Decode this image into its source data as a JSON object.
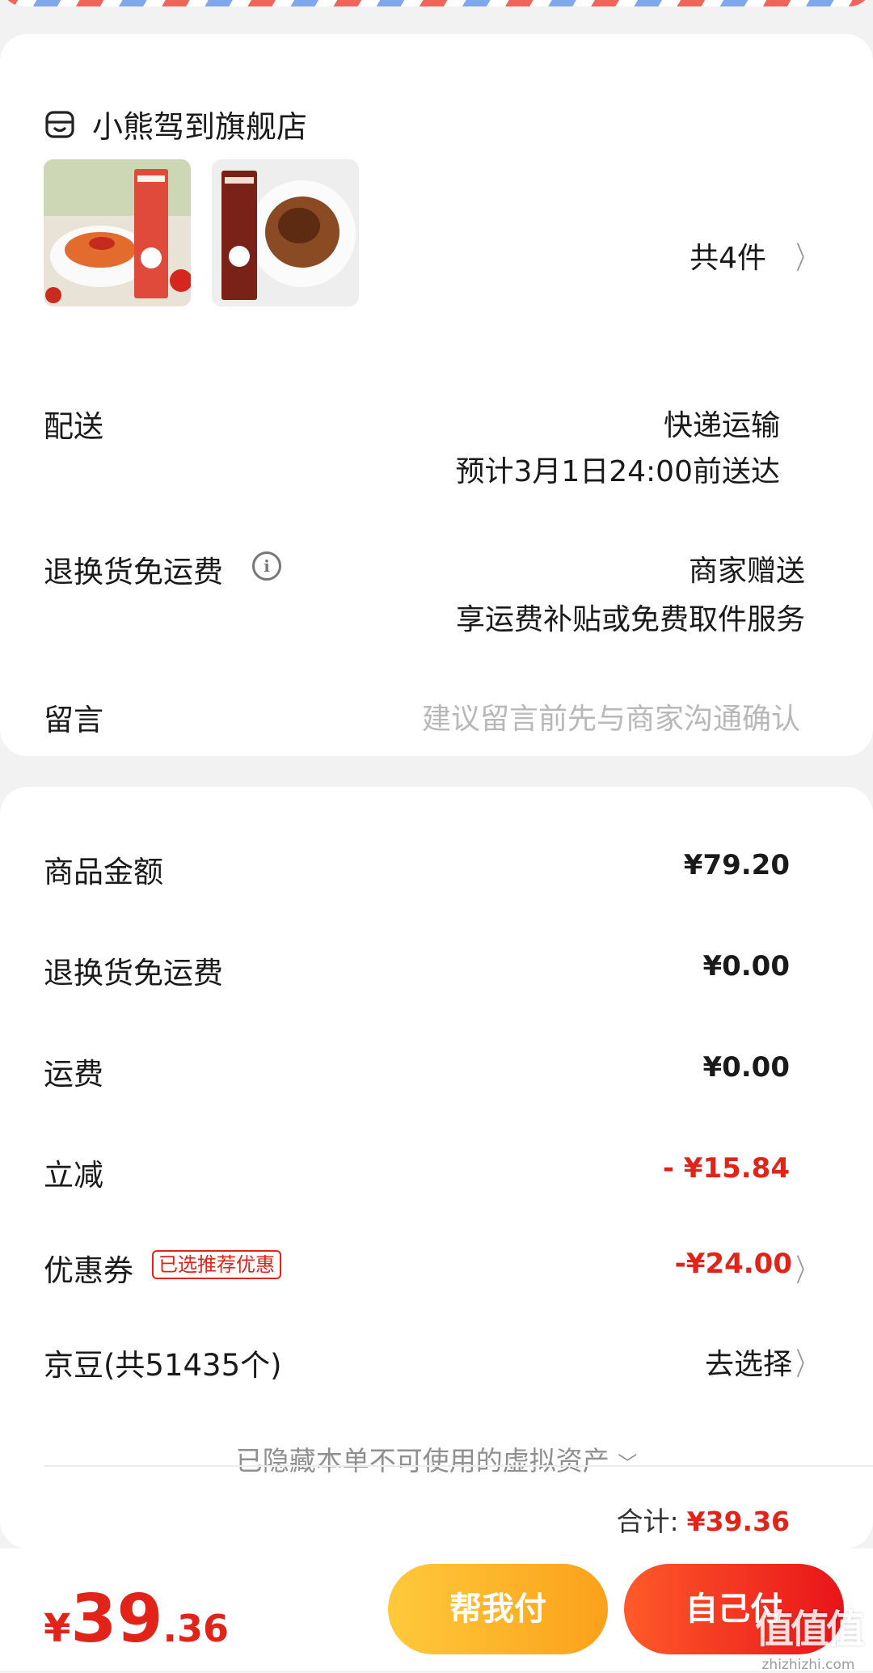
{
  "shop": {
    "icon": "store-icon",
    "name": "小熊驾到旗舰店",
    "products": [
      {
        "image": "tomato-spaghetti-image"
      },
      {
        "image": "beef-spaghetti-image"
      }
    ],
    "count_label": "共4件"
  },
  "delivery": {
    "label": "配送",
    "method": "快递运输",
    "eta": "预计3月1日24:00前送达"
  },
  "return_shipping": {
    "label": "退换货免运费",
    "info_icon": "info-icon",
    "value": "商家赠送",
    "desc": "享运费补贴或免费取件服务"
  },
  "message": {
    "label": "留言",
    "placeholder": "建议留言前先与商家沟通确认"
  },
  "fees": {
    "goods_label": "商品金额",
    "goods_value": "¥79.20",
    "return_label": "退换货免运费",
    "return_value": "¥0.00",
    "freight_label": "运费",
    "freight_value": "¥0.00",
    "discount_label": "立减",
    "discount_value": "- ¥15.84",
    "coupon_label": "优惠券",
    "coupon_tag": "已选推荐优惠",
    "coupon_value": "-¥24.00",
    "beans_label": "京豆(共51435个)",
    "beans_action": "去选择"
  },
  "hidden_assets": "已隐藏本单不可使用的虚拟资产",
  "total": {
    "label": "合计:",
    "value": "¥39.36"
  },
  "bottom": {
    "currency": "¥",
    "price_int": "39",
    "price_dec": ".36",
    "help_pay": "帮我付",
    "self_pay": "自己付"
  },
  "watermark": {
    "logo": "值值值",
    "url": "zhizhizhi.com"
  },
  "colors": {
    "accent_red": "#e2231a",
    "help_button": "#fbb224",
    "self_button": "#f02a1e"
  }
}
